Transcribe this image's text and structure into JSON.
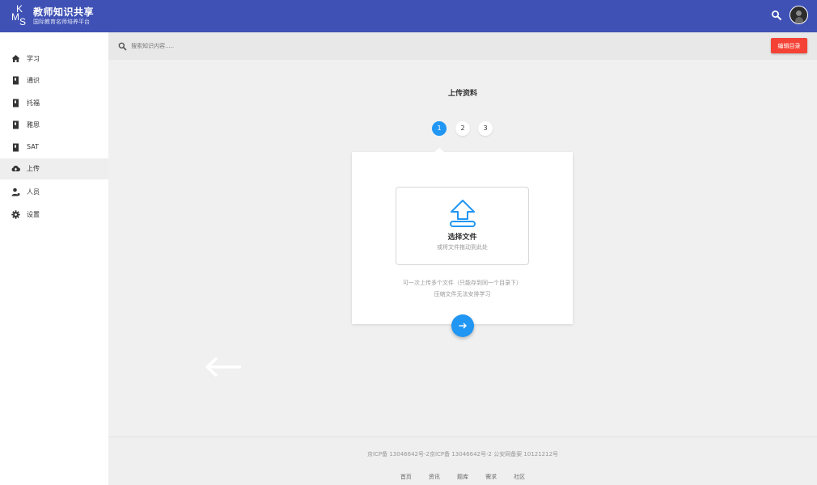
{
  "header": {
    "logo_letters": [
      "K",
      "M",
      "S"
    ],
    "title": "教师知识共享",
    "subtitle": "国际教育名师培养平台",
    "color": "#3f51b5"
  },
  "sidebar": {
    "items": [
      {
        "label": "学习",
        "icon": "home-icon",
        "active": false
      },
      {
        "label": "通识",
        "icon": "book-icon",
        "active": false
      },
      {
        "label": "托福",
        "icon": "book-icon",
        "active": false
      },
      {
        "label": "雅思",
        "icon": "book-icon",
        "active": false
      },
      {
        "label": "SAT",
        "icon": "book-icon",
        "active": false
      },
      {
        "label": "上传",
        "icon": "cloud-upload-icon",
        "active": true
      },
      {
        "label": "人员",
        "icon": "person-icon",
        "active": false
      },
      {
        "label": "设置",
        "icon": "gear-icon",
        "active": false
      }
    ]
  },
  "toolbar": {
    "search_placeholder": "搜索知识内容.....",
    "edit_button": "编辑目录",
    "edit_button_color": "#f44336"
  },
  "main": {
    "title": "上传资料",
    "steps": [
      "1",
      "2",
      "3"
    ],
    "current_step": 1,
    "dropzone": {
      "title": "选择文件",
      "subtitle": "或将文件拖动到此处"
    },
    "notes": [
      "可一次上传多个文件（只能存到同一个目录下）",
      "压缩文件无法安排学习"
    ],
    "accent": "#2196f3"
  },
  "footer": {
    "icp": "京ICP备 13046642号-2京ICP备 13046642号-2 公安网备案  10121212号",
    "links": [
      "首页",
      "资讯",
      "题库",
      "需求",
      "社区"
    ]
  }
}
